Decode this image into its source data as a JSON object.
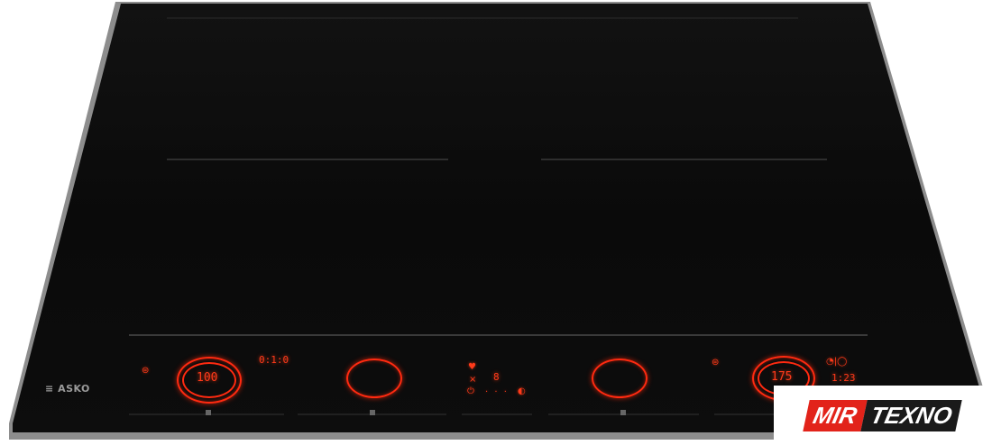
{
  "cooktop": {
    "brand": "ASKO",
    "left_zone": {
      "power_display": "100",
      "timer_display": "0:1:0"
    },
    "center_panel": {
      "level_display": "8"
    },
    "right_zone": {
      "power_display": "175",
      "timer_display": "1:23"
    },
    "colors": {
      "glass": "#0b0b0b",
      "frame": "#8d8d8d",
      "led": "#ff3a1a"
    }
  },
  "watermark": {
    "part1": "MIR",
    "part2": "TEXNO"
  }
}
